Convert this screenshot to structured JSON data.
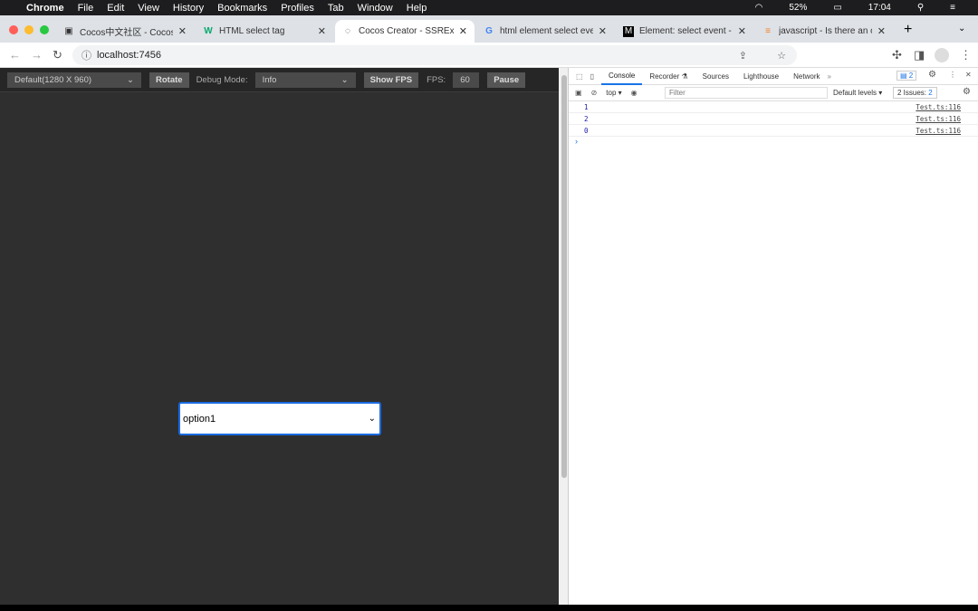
{
  "menubar": {
    "app": "Chrome",
    "items": [
      "File",
      "Edit",
      "View",
      "History",
      "Bookmarks",
      "Profiles",
      "Tab",
      "Window",
      "Help"
    ],
    "battery": "52%",
    "time": "17:04"
  },
  "tabs": [
    {
      "title": "Cocos中文社区 - Cocos中",
      "icon": "cocos-icon"
    },
    {
      "title": "HTML select tag",
      "icon": "w3-icon"
    },
    {
      "title": "Cocos Creator - SSRExte",
      "icon": "cocos-creator-icon"
    },
    {
      "title": "html element select even",
      "icon": "google-icon"
    },
    {
      "title": "Element: select event - W",
      "icon": "mdn-icon"
    },
    {
      "title": "javascript - Is there an or",
      "icon": "stackoverflow-icon"
    }
  ],
  "address": "localhost:7456",
  "cocos": {
    "resolution": "Default(1280 X 960)",
    "rotate": "Rotate",
    "debug_label": "Debug Mode:",
    "debug_value": "Info",
    "show_fps": "Show FPS",
    "fps_label": "FPS:",
    "fps_value": "60",
    "pause": "Pause"
  },
  "game_select": {
    "value": "option1"
  },
  "devtools": {
    "tabs": [
      "Console",
      "Recorder ⚗",
      "Sources",
      "Lighthouse",
      "Network"
    ],
    "issues_badge": "2",
    "context": "top ▾",
    "filter_placeholder": "Filter",
    "levels": "Default levels ▾",
    "issues": "2 Issues:",
    "issues_count": "2",
    "logs": [
      {
        "value": "1",
        "source": "Test.ts:116"
      },
      {
        "value": "2",
        "source": "Test.ts:116"
      },
      {
        "value": "0",
        "source": "Test.ts:116"
      }
    ],
    "prompt": "›"
  }
}
